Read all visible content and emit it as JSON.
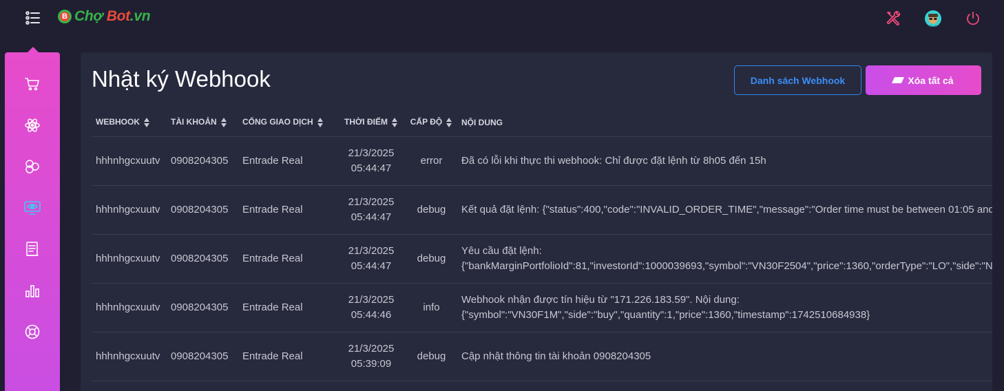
{
  "brand": {
    "part1": "Chợ ",
    "part2": "Bot",
    "part3": ".vn",
    "badge": "B"
  },
  "page": {
    "title": "Nhật ký Webhook"
  },
  "buttons": {
    "webhook_list": "Danh sách Webhook",
    "clear_all": "Xóa tất cả"
  },
  "table": {
    "headers": [
      "WEBHOOK",
      "TÀI KHOẢN",
      "CỔNG GIAO DỊCH",
      "THỜI ĐIỂM",
      "CẤP ĐỘ",
      "NỘI DUNG"
    ],
    "rows": [
      {
        "webhook": "hhhnhgcxuutv",
        "account": "0908204305",
        "gateway": "Entrade Real",
        "date": "21/3/2025",
        "time": "05:44:47",
        "level": "error",
        "content1": "Đã có lỗi khi thực thi webhook: Chỉ được đặt lệnh từ 8h05 đến 15h",
        "content2": ""
      },
      {
        "webhook": "hhhnhgcxuutv",
        "account": "0908204305",
        "gateway": "Entrade Real",
        "date": "21/3/2025",
        "time": "05:44:47",
        "level": "debug",
        "content1": "Kết quả đặt lệnh: {\"status\":400,\"code\":\"INVALID_ORDER_TIME\",\"message\":\"Order time must be between 01:05 and",
        "content2": ""
      },
      {
        "webhook": "hhhnhgcxuutv",
        "account": "0908204305",
        "gateway": "Entrade Real",
        "date": "21/3/2025",
        "time": "05:44:47",
        "level": "debug",
        "content1": "Yêu cầu đặt lệnh:",
        "content2": "{\"bankMarginPortfolioId\":81,\"investorId\":1000039693,\"symbol\":\"VN30F2504\",\"price\":1360,\"orderType\":\"LO\",\"side\":\"N"
      },
      {
        "webhook": "hhhnhgcxuutv",
        "account": "0908204305",
        "gateway": "Entrade Real",
        "date": "21/3/2025",
        "time": "05:44:46",
        "level": "info",
        "content1": "Webhook nhận được tín hiệu từ \"171.226.183.59\". Nội dung:",
        "content2": "{\"symbol\":\"VN30F1M\",\"side\":\"buy\",\"quantity\":1,\"price\":1360,\"timestamp\":1742510684938}"
      },
      {
        "webhook": "hhhnhgcxuutv",
        "account": "0908204305",
        "gateway": "Entrade Real",
        "date": "21/3/2025",
        "time": "05:39:09",
        "level": "debug",
        "content1": "Cập nhật thông tin tài khoản 0908204305",
        "content2": ""
      }
    ]
  },
  "colors": {
    "bg": "#1f1f31",
    "card": "#27293d",
    "accent_pink": "#e64ccb",
    "accent_blue": "#3b8ff5",
    "error": "#f5365c"
  },
  "icons": {
    "topbar": [
      "menu-list-icon",
      "tools-icon",
      "user-avatar-icon",
      "power-icon"
    ],
    "sidebar": [
      "cart-icon",
      "atom-icon",
      "hexagons-icon",
      "eye-screen-icon",
      "document-icon",
      "bar-chart-icon",
      "lifebuoy-icon"
    ]
  }
}
